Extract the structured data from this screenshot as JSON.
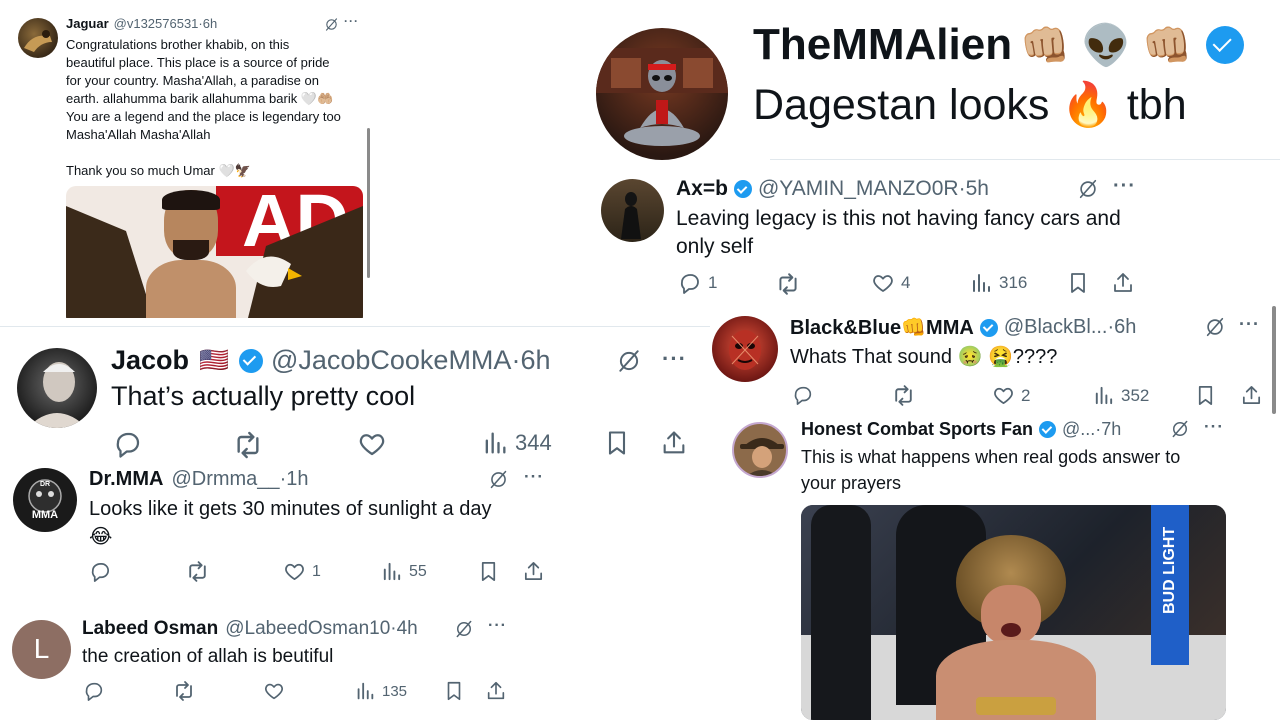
{
  "jaguar": {
    "name": "Jaguar",
    "handle": "@v132576531",
    "time": "6h",
    "body_lines": [
      "Congratulations brother khabib, on this",
      "beautiful place. This place is a source of pride",
      "for your country. Masha'Allah, a paradise on",
      "earth. allahumma barik  allahumma barik 🤍🤲🏼",
      "You are a legend and the place is legendary too",
      "Masha'Allah Masha'Allah",
      "",
      "Thank you so much Umar 🤍🦅"
    ],
    "image_text": "AD"
  },
  "alien": {
    "name": "TheMMAlien",
    "emojis": "👊🏼 👽 👊🏼",
    "text": "Dagestan looks 🔥 tbh"
  },
  "axb": {
    "name": "Ax=b",
    "handle": "@YAMIN_MANZO0R",
    "time": "5h",
    "text_lines": [
      "Leaving legacy is this not having fancy cars and",
      "only self"
    ],
    "replies": "1",
    "likes": "4",
    "views": "316"
  },
  "blackblue": {
    "name": "Black&Blue👊MMA",
    "handle": "@BlackBl...",
    "time": "6h",
    "text": "Whats That sound 🤢 🤮????",
    "likes": "2",
    "views": "352"
  },
  "honest": {
    "name": "Honest Combat Sports Fan",
    "handle": "@...",
    "time": "7h",
    "text_lines": [
      "This is what happens when real gods answer to",
      "your prayers"
    ],
    "photo_sign": "BUD LIGHT"
  },
  "jacob": {
    "name": "Jacob",
    "flag": "🇺🇸",
    "handle": "@JacobCookeMMA",
    "time": "6h",
    "text": "That’s actually pretty cool",
    "views": "344"
  },
  "drmma": {
    "name": "Dr.MMA",
    "handle": "@Drmma__",
    "time": "1h",
    "text_line1": "Looks like it gets 30 minutes of sunlight a day",
    "text_line2": "😂",
    "likes": "1",
    "views": "55",
    "avatar_top": "DR",
    "avatar_text": "MMA"
  },
  "labeed": {
    "name": "Labeed Osman",
    "handle": "@LabeedOsman10",
    "time": "4h",
    "text": "the creation of allah is beutiful",
    "views": "135",
    "avatar_letter": "L"
  },
  "separator": "·",
  "more": "···"
}
